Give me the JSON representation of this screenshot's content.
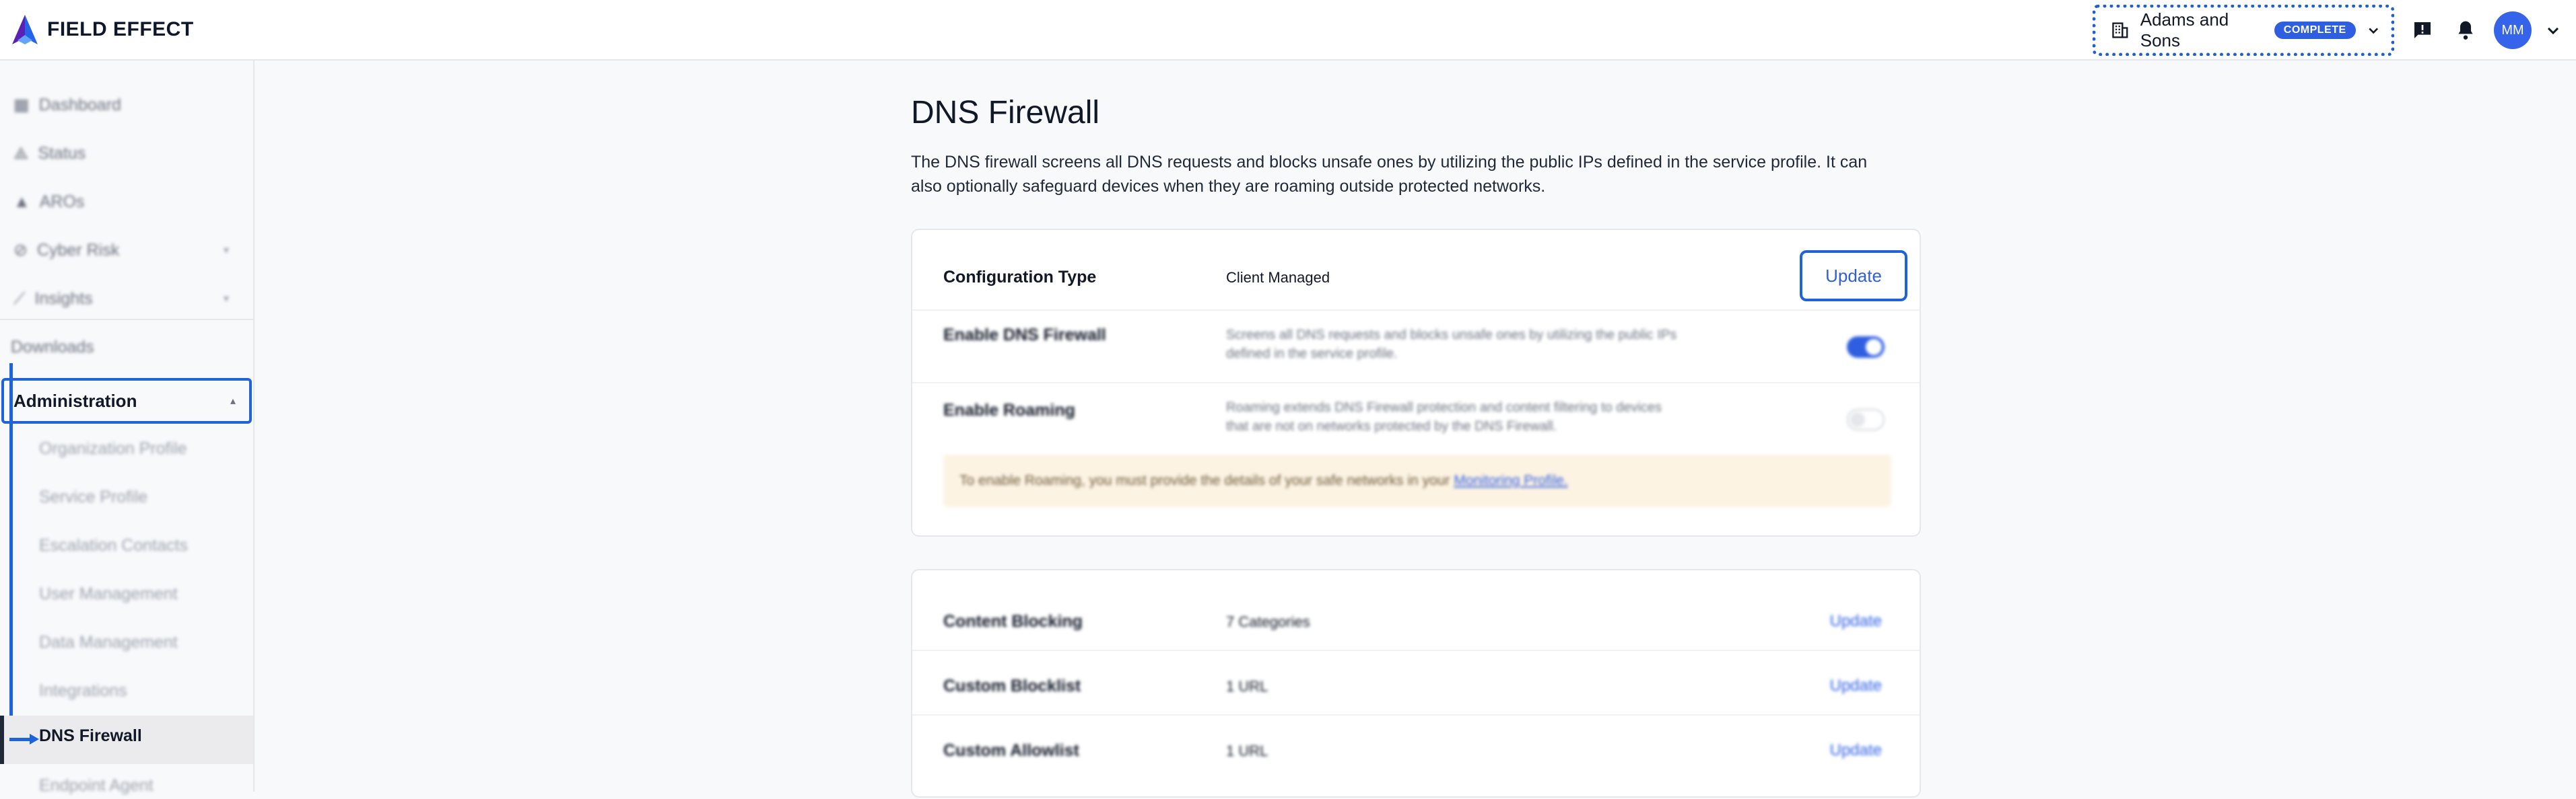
{
  "brand": {
    "name": "FIELD EFFECT"
  },
  "header": {
    "org_name": "Adams and Sons",
    "org_badge": "COMPLETE",
    "avatar_initials": "MM"
  },
  "sidebar": {
    "items": [
      {
        "label": "Dashboard"
      },
      {
        "label": "Status"
      },
      {
        "label": "AROs"
      },
      {
        "label": "Cyber Risk"
      },
      {
        "label": "Insights"
      }
    ],
    "downloads": "Downloads",
    "administration": "Administration",
    "admin_items": [
      {
        "label": "Organization Profile"
      },
      {
        "label": "Service Profile"
      },
      {
        "label": "Escalation Contacts"
      },
      {
        "label": "User Management"
      },
      {
        "label": "Data Management"
      },
      {
        "label": "Integrations"
      },
      {
        "label": "DNS Firewall"
      },
      {
        "label": "Endpoint Agent"
      }
    ]
  },
  "main": {
    "title": "DNS Firewall",
    "description": "The DNS firewall screens all DNS requests and blocks unsafe ones by utilizing the public IPs defined in the service profile. It can also optionally safeguard devices when they are roaming outside protected networks.",
    "config": {
      "label": "Configuration Type",
      "value": "Client Managed",
      "update_label": "Update"
    },
    "enable_firewall": {
      "label": "Enable DNS Firewall",
      "desc": "Screens all DNS requests and blocks unsafe ones by utilizing the public IPs defined in the service profile.",
      "enabled": true
    },
    "enable_roaming": {
      "label": "Enable Roaming",
      "desc": "Roaming extends DNS Firewall protection and content filtering to devices that are not on networks protected by the DNS Firewall.",
      "enabled": false
    },
    "notice": {
      "text": "To enable Roaming, you must provide the details of your safe networks in your",
      "link": "Monitoring Profile."
    },
    "lists": [
      {
        "label": "Content Blocking",
        "value": "7 Categories",
        "action": "Update"
      },
      {
        "label": "Custom Blocklist",
        "value": "1 URL",
        "action": "Update"
      },
      {
        "label": "Custom Allowlist",
        "value": "1 URL",
        "action": "Update"
      }
    ]
  },
  "colors": {
    "accent": "#2f5fe0",
    "focus": "#1f63d8",
    "notice_bg": "#fdf3e3"
  }
}
